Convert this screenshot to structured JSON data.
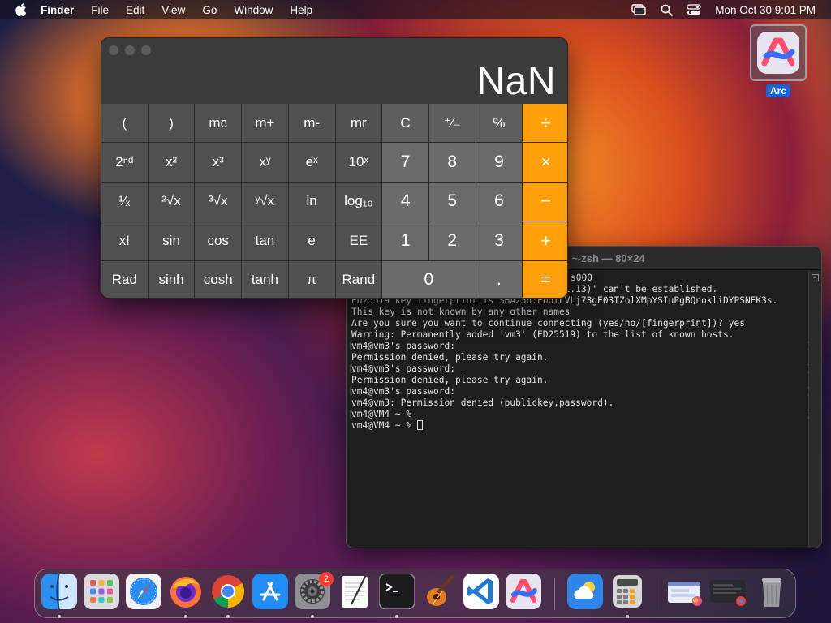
{
  "menubar": {
    "app_name": "Finder",
    "menus": [
      "File",
      "Edit",
      "View",
      "Go",
      "Window",
      "Help"
    ],
    "clock": "Mon Oct 30  9:01 PM"
  },
  "desktop": {
    "arc_label": "Arc"
  },
  "calculator": {
    "display": "NaN",
    "keys": [
      {
        "label": "(",
        "kind": "sci"
      },
      {
        "label": ")",
        "kind": "sci"
      },
      {
        "label": "mc",
        "kind": "sci"
      },
      {
        "label": "m+",
        "kind": "sci"
      },
      {
        "label": "m-",
        "kind": "sci"
      },
      {
        "label": "mr",
        "kind": "sci"
      },
      {
        "label": "C",
        "kind": "fn"
      },
      {
        "label": "⁺∕₋",
        "kind": "fn"
      },
      {
        "label": "%",
        "kind": "fn"
      },
      {
        "label": "÷",
        "kind": "op"
      },
      {
        "label": "2ⁿᵈ",
        "kind": "sci"
      },
      {
        "label": "x²",
        "kind": "sci"
      },
      {
        "label": "x³",
        "kind": "sci"
      },
      {
        "label": "xʸ",
        "kind": "sci"
      },
      {
        "label": "eˣ",
        "kind": "sci"
      },
      {
        "label": "10ˣ",
        "kind": "sci"
      },
      {
        "label": "7",
        "kind": "num"
      },
      {
        "label": "8",
        "kind": "num"
      },
      {
        "label": "9",
        "kind": "num"
      },
      {
        "label": "×",
        "kind": "op"
      },
      {
        "label": "¹∕ₓ",
        "kind": "sci"
      },
      {
        "label": "²√x",
        "kind": "sci"
      },
      {
        "label": "³√x",
        "kind": "sci"
      },
      {
        "label": "ʸ√x",
        "kind": "sci"
      },
      {
        "label": "ln",
        "kind": "sci"
      },
      {
        "label": "log₁₀",
        "kind": "sci"
      },
      {
        "label": "4",
        "kind": "num"
      },
      {
        "label": "5",
        "kind": "num"
      },
      {
        "label": "6",
        "kind": "num"
      },
      {
        "label": "−",
        "kind": "op"
      },
      {
        "label": "x!",
        "kind": "sci"
      },
      {
        "label": "sin",
        "kind": "sci"
      },
      {
        "label": "cos",
        "kind": "sci"
      },
      {
        "label": "tan",
        "kind": "sci"
      },
      {
        "label": "e",
        "kind": "sci"
      },
      {
        "label": "EE",
        "kind": "sci"
      },
      {
        "label": "1",
        "kind": "num"
      },
      {
        "label": "2",
        "kind": "num"
      },
      {
        "label": "3",
        "kind": "num"
      },
      {
        "label": "+",
        "kind": "op"
      },
      {
        "label": "Rad",
        "kind": "sci"
      },
      {
        "label": "sinh",
        "kind": "sci"
      },
      {
        "label": "cosh",
        "kind": "sci"
      },
      {
        "label": "tanh",
        "kind": "sci"
      },
      {
        "label": "π",
        "kind": "sci"
      },
      {
        "label": "Rand",
        "kind": "sci"
      },
      {
        "label": "0",
        "kind": "num zero"
      },
      {
        "label": ".",
        "kind": "num"
      },
      {
        "label": "=",
        "kind": "op"
      }
    ]
  },
  "terminal": {
    "title": "~-zsh — 80×24",
    "lines": [
      "s000",
      "The authenticity of host 'vm3 (192.168.1.13)' can't be established.",
      "ED25519 key fingerprint is SHA256:EbdtLVLj73gE03TZolXMpYSIuPgBQnokliDYPSNEK3s.",
      "This key is not known by any other names",
      "Are you sure you want to continue connecting (yes/no/[fingerprint])? yes",
      "Warning: Permanently added 'vm3' (ED25519) to the list of known hosts.",
      "vm4@vm3's password:",
      "Permission denied, please try again.",
      "vm4@vm3's password:",
      "Permission denied, please try again.",
      "vm4@vm3's password:",
      "vm4@vm3: Permission denied (publickey,password).",
      "vm4@VM4 ~ %",
      "vm4@VM4 ~ % "
    ],
    "marked_lines": [
      6,
      8,
      10,
      12
    ]
  },
  "dock": {
    "apps": [
      {
        "name": "Finder",
        "icon": "finder-icon",
        "running": true
      },
      {
        "name": "Launchpad",
        "icon": "launchpad-icon",
        "running": false
      },
      {
        "name": "Safari",
        "icon": "safari-icon",
        "running": false
      },
      {
        "name": "Firefox",
        "icon": "firefox-icon",
        "running": true
      },
      {
        "name": "Google Chrome",
        "icon": "chrome-icon",
        "running": true
      },
      {
        "name": "App Store",
        "icon": "app-store-icon",
        "running": false
      },
      {
        "name": "System Settings",
        "icon": "system-settings-icon",
        "running": true,
        "badge": "2"
      },
      {
        "name": "TextEdit",
        "icon": "textedit-icon",
        "running": false
      },
      {
        "name": "Terminal",
        "icon": "terminal-icon",
        "running": true
      },
      {
        "name": "GarageBand",
        "icon": "garageband-icon",
        "running": false
      },
      {
        "name": "Visual Studio Code",
        "icon": "vscode-icon",
        "running": false
      },
      {
        "name": "Arc",
        "icon": "arc-icon",
        "running": false
      },
      {
        "name": "Weather",
        "icon": "weather-icon",
        "running": false
      },
      {
        "name": "Calculator",
        "icon": "calculator-icon",
        "running": true
      },
      {
        "name": "Downloads stack",
        "icon": "stack-icon",
        "running": false
      },
      {
        "name": "Recent window",
        "icon": "window-preview-icon",
        "running": false
      },
      {
        "name": "Trash",
        "icon": "trash-icon",
        "running": false
      }
    ]
  },
  "colors": {
    "calc_operator": "#ff9f0a",
    "terminal_bg": "#1e1e1e"
  }
}
